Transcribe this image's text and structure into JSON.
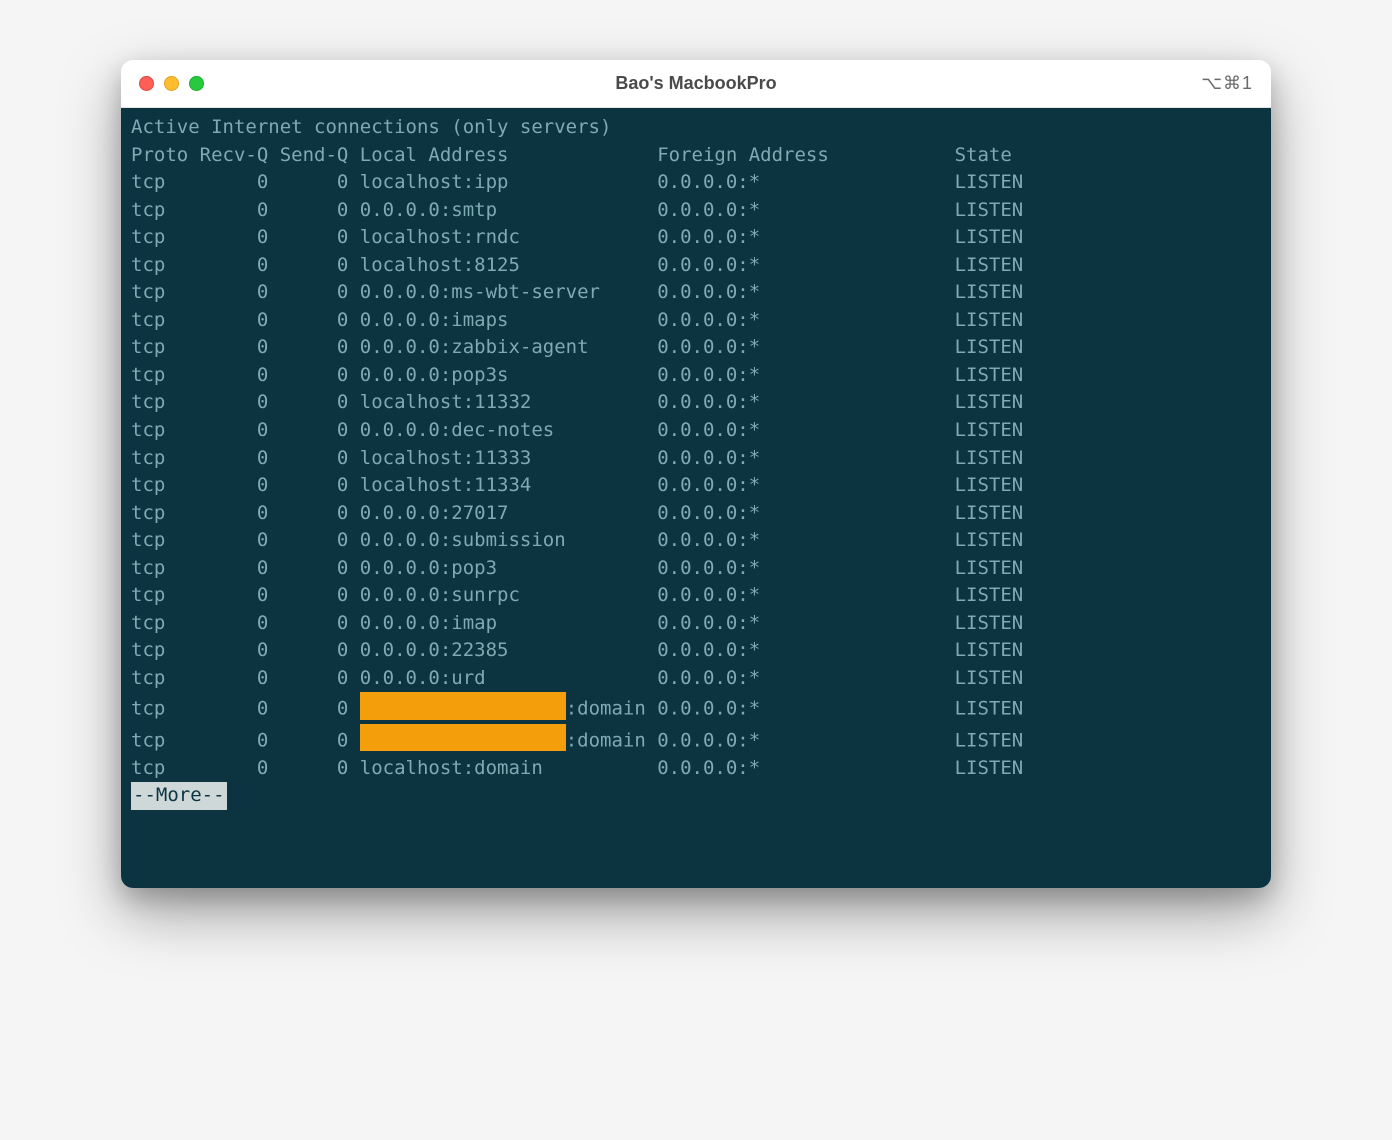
{
  "window": {
    "title": "Bao's MacbookPro",
    "tab_indicator": "⌥⌘1"
  },
  "output": {
    "heading": "Active Internet connections (only servers)",
    "columns": {
      "proto": "Proto",
      "recvq": "Recv-Q",
      "sendq": "Send-Q",
      "local": "Local Address",
      "foreign": "Foreign Address",
      "state": "State"
    },
    "rows": [
      {
        "proto": "tcp",
        "recvq": "0",
        "sendq": "0",
        "local": "localhost:ipp",
        "local_redacted": false,
        "local_suffix": "",
        "foreign": "0.0.0.0:*",
        "state": "LISTEN"
      },
      {
        "proto": "tcp",
        "recvq": "0",
        "sendq": "0",
        "local": "0.0.0.0:smtp",
        "local_redacted": false,
        "local_suffix": "",
        "foreign": "0.0.0.0:*",
        "state": "LISTEN"
      },
      {
        "proto": "tcp",
        "recvq": "0",
        "sendq": "0",
        "local": "localhost:rndc",
        "local_redacted": false,
        "local_suffix": "",
        "foreign": "0.0.0.0:*",
        "state": "LISTEN"
      },
      {
        "proto": "tcp",
        "recvq": "0",
        "sendq": "0",
        "local": "localhost:8125",
        "local_redacted": false,
        "local_suffix": "",
        "foreign": "0.0.0.0:*",
        "state": "LISTEN"
      },
      {
        "proto": "tcp",
        "recvq": "0",
        "sendq": "0",
        "local": "0.0.0.0:ms-wbt-server",
        "local_redacted": false,
        "local_suffix": "",
        "foreign": "0.0.0.0:*",
        "state": "LISTEN"
      },
      {
        "proto": "tcp",
        "recvq": "0",
        "sendq": "0",
        "local": "0.0.0.0:imaps",
        "local_redacted": false,
        "local_suffix": "",
        "foreign": "0.0.0.0:*",
        "state": "LISTEN"
      },
      {
        "proto": "tcp",
        "recvq": "0",
        "sendq": "0",
        "local": "0.0.0.0:zabbix-agent",
        "local_redacted": false,
        "local_suffix": "",
        "foreign": "0.0.0.0:*",
        "state": "LISTEN"
      },
      {
        "proto": "tcp",
        "recvq": "0",
        "sendq": "0",
        "local": "0.0.0.0:pop3s",
        "local_redacted": false,
        "local_suffix": "",
        "foreign": "0.0.0.0:*",
        "state": "LISTEN"
      },
      {
        "proto": "tcp",
        "recvq": "0",
        "sendq": "0",
        "local": "localhost:11332",
        "local_redacted": false,
        "local_suffix": "",
        "foreign": "0.0.0.0:*",
        "state": "LISTEN"
      },
      {
        "proto": "tcp",
        "recvq": "0",
        "sendq": "0",
        "local": "0.0.0.0:dec-notes",
        "local_redacted": false,
        "local_suffix": "",
        "foreign": "0.0.0.0:*",
        "state": "LISTEN"
      },
      {
        "proto": "tcp",
        "recvq": "0",
        "sendq": "0",
        "local": "localhost:11333",
        "local_redacted": false,
        "local_suffix": "",
        "foreign": "0.0.0.0:*",
        "state": "LISTEN"
      },
      {
        "proto": "tcp",
        "recvq": "0",
        "sendq": "0",
        "local": "localhost:11334",
        "local_redacted": false,
        "local_suffix": "",
        "foreign": "0.0.0.0:*",
        "state": "LISTEN"
      },
      {
        "proto": "tcp",
        "recvq": "0",
        "sendq": "0",
        "local": "0.0.0.0:27017",
        "local_redacted": false,
        "local_suffix": "",
        "foreign": "0.0.0.0:*",
        "state": "LISTEN"
      },
      {
        "proto": "tcp",
        "recvq": "0",
        "sendq": "0",
        "local": "0.0.0.0:submission",
        "local_redacted": false,
        "local_suffix": "",
        "foreign": "0.0.0.0:*",
        "state": "LISTEN"
      },
      {
        "proto": "tcp",
        "recvq": "0",
        "sendq": "0",
        "local": "0.0.0.0:pop3",
        "local_redacted": false,
        "local_suffix": "",
        "foreign": "0.0.0.0:*",
        "state": "LISTEN"
      },
      {
        "proto": "tcp",
        "recvq": "0",
        "sendq": "0",
        "local": "0.0.0.0:sunrpc",
        "local_redacted": false,
        "local_suffix": "",
        "foreign": "0.0.0.0:*",
        "state": "LISTEN"
      },
      {
        "proto": "tcp",
        "recvq": "0",
        "sendq": "0",
        "local": "0.0.0.0:imap",
        "local_redacted": false,
        "local_suffix": "",
        "foreign": "0.0.0.0:*",
        "state": "LISTEN"
      },
      {
        "proto": "tcp",
        "recvq": "0",
        "sendq": "0",
        "local": "0.0.0.0:22385",
        "local_redacted": false,
        "local_suffix": "",
        "foreign": "0.0.0.0:*",
        "state": "LISTEN"
      },
      {
        "proto": "tcp",
        "recvq": "0",
        "sendq": "0",
        "local": "0.0.0.0:urd",
        "local_redacted": false,
        "local_suffix": "",
        "foreign": "0.0.0.0:*",
        "state": "LISTEN"
      },
      {
        "proto": "tcp",
        "recvq": "0",
        "sendq": "0",
        "local": "",
        "local_redacted": true,
        "local_suffix": ":domain",
        "foreign": "0.0.0.0:*",
        "state": "LISTEN"
      },
      {
        "proto": "tcp",
        "recvq": "0",
        "sendq": "0",
        "local": "",
        "local_redacted": true,
        "local_suffix": ":domain",
        "foreign": "0.0.0.0:*",
        "state": "LISTEN"
      },
      {
        "proto": "tcp",
        "recvq": "0",
        "sendq": "0",
        "local": "localhost:domain",
        "local_redacted": false,
        "local_suffix": "",
        "foreign": "0.0.0.0:*",
        "state": "LISTEN"
      }
    ],
    "more_prompt": "--More--"
  },
  "widths": {
    "proto": 6,
    "recvq": 7,
    "sendq": 7,
    "local": 26,
    "foreign": 26,
    "state": 7,
    "redact_chars": 18
  }
}
